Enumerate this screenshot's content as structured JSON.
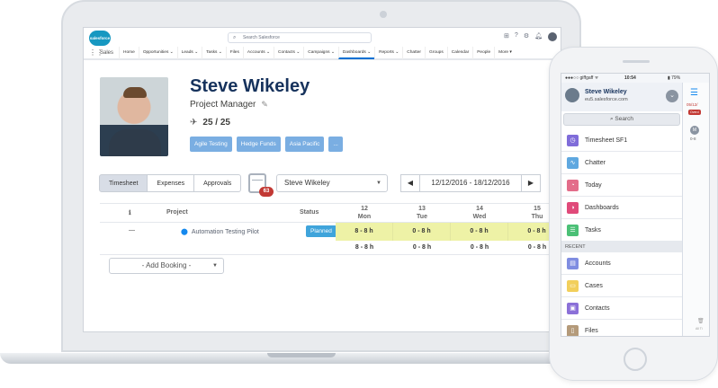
{
  "salesforce": {
    "logo_text": "salesforce",
    "search_placeholder": "Search Salesforce",
    "app_name": "Sales",
    "nav": [
      "Home",
      "Opportunities ⌄",
      "Leads ⌄",
      "Tasks ⌄",
      "Files",
      "Accounts ⌄",
      "Contacts ⌄",
      "Campaigns ⌄",
      "Dashboards ⌄",
      "Reports ⌄",
      "Chatter",
      "Groups",
      "Calendar",
      "People",
      "More ▾"
    ],
    "active_nav_index": 8
  },
  "profile": {
    "name": "Steve Wikeley",
    "role": "Project Manager",
    "hours": "25 / 25",
    "tags": [
      "Agile Testing",
      "Hedge Funds",
      "Asia Pacific",
      "..."
    ]
  },
  "toolbar": {
    "tabs": [
      "Timesheet",
      "Expenses",
      "Approvals"
    ],
    "active_tab": 0,
    "calendar_badge": "63",
    "user_select": "Steve Wikeley",
    "date_range": "12/12/2016 - 18/12/2016",
    "prev": "◀",
    "next": "▶"
  },
  "table": {
    "headers": {
      "info": "ℹ",
      "project": "Project",
      "status": "Status"
    },
    "days": [
      {
        "num": "12",
        "name": "Mon"
      },
      {
        "num": "13",
        "name": "Tue"
      },
      {
        "num": "14",
        "name": "Wed"
      },
      {
        "num": "15",
        "name": "Thu"
      }
    ],
    "row": {
      "dash": "—",
      "project": "Automation Testing Pilot",
      "status": "Planned",
      "cells": [
        "8 - 8 h",
        "0 - 8 h",
        "0 - 8 h",
        "0 - 8 h"
      ]
    },
    "totals": [
      "8 - 8 h",
      "0 - 8 h",
      "0 - 8 h",
      "0 - 8 h"
    ],
    "add_booking": "- Add Booking -"
  },
  "phone": {
    "carrier": "●●●○○ giffgaff ᯤ",
    "time": "10:54",
    "battery": "▮ 79%",
    "user_name": "Steve Wikeley",
    "org": "eu5.salesforce.com",
    "search": "Search",
    "menu": [
      {
        "label": "Timesheet SF1",
        "color": "#7f6cd9",
        "icon": "timesheet-icon"
      },
      {
        "label": "Chatter",
        "color": "#5fa8e0",
        "icon": "chatter-icon"
      },
      {
        "label": "Today",
        "color": "#e36d8a",
        "icon": "today-icon"
      },
      {
        "label": "Dashboards",
        "color": "#e04a7a",
        "icon": "dashboards-icon"
      },
      {
        "label": "Tasks",
        "color": "#4bc076",
        "icon": "tasks-icon"
      }
    ],
    "recent_label": "RECENT",
    "recent": [
      {
        "label": "Accounts",
        "color": "#7f8de1",
        "icon": "accounts-icon"
      },
      {
        "label": "Cases",
        "color": "#f2cf5b",
        "icon": "cases-icon"
      },
      {
        "label": "Contacts",
        "color": "#8b70d8",
        "icon": "contacts-icon"
      },
      {
        "label": "Files",
        "color": "#b49a7a",
        "icon": "files-icon"
      }
    ],
    "right_date": "05/12/",
    "right_badge": "Overd",
    "right_avatar": "M",
    "right_small": "0-8",
    "right_footer": "All Ti"
  },
  "colors": {
    "accent": "#0070d2",
    "badge": "#c23934",
    "tag": "#7aaee2",
    "cell_highlight": "#eef2a6"
  }
}
